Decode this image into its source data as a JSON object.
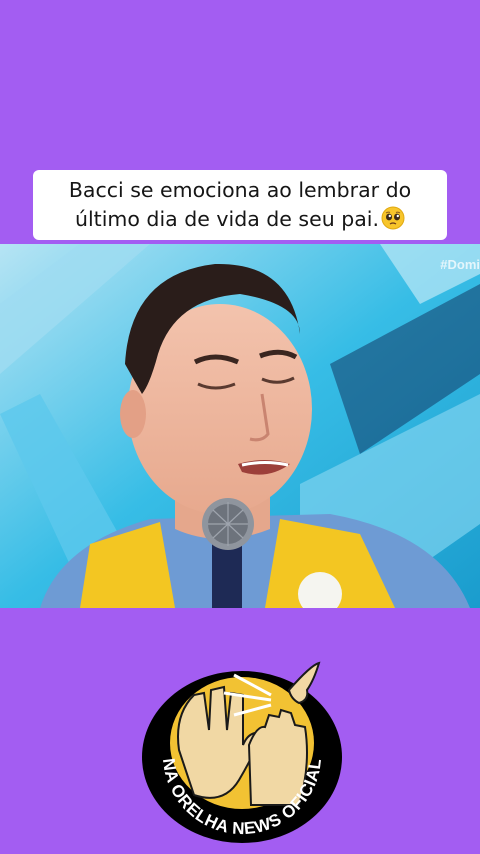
{
  "caption": {
    "line1": "Bacci se emociona ao lembrar do",
    "line2": "último dia de vida de seu pai.",
    "emoji": "pleading-face-emoji"
  },
  "video": {
    "watermark": "#Domi"
  },
  "logo": {
    "text": "NA ORELHA NEWS OFICIAL"
  },
  "colors": {
    "background": "#a35df2",
    "caption_bg": "#ffffff",
    "logo_bg": "#000000",
    "logo_ring": "#f2c233",
    "studio_cyan": "#2fb9e3",
    "vest_yellow": "#f3c622"
  }
}
